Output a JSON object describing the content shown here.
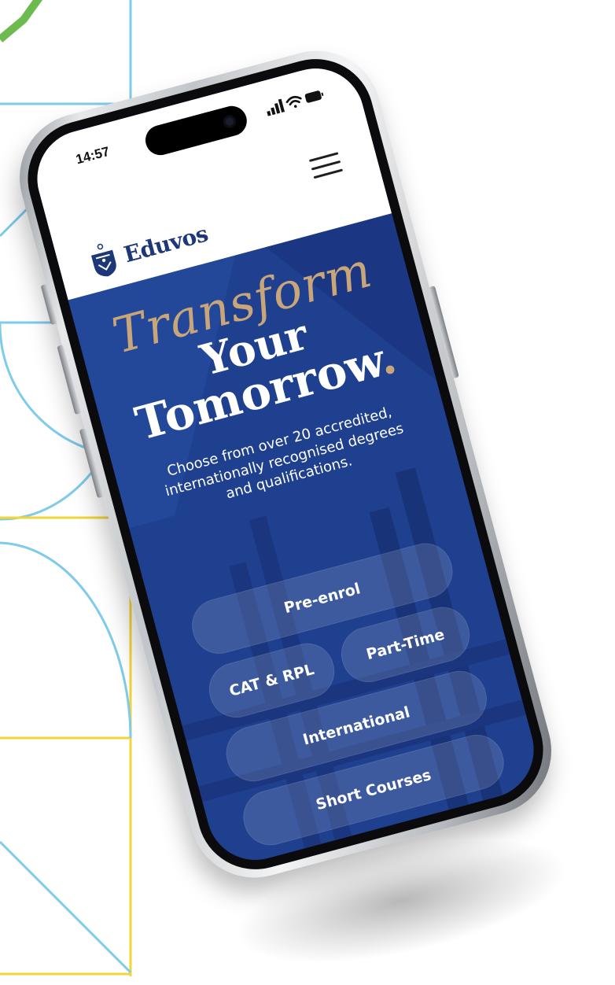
{
  "status_bar": {
    "time": "14:57"
  },
  "header": {
    "brand": "Eduvos",
    "menu_icon": "hamburger-menu-icon",
    "crest_icon": "crest-logo-icon"
  },
  "hero": {
    "line1": "Transform",
    "line2": "Your",
    "line3": "Tomorrow",
    "dot": ".",
    "subtitle": "Choose from over 20 accredited, internationally recognised degrees and qualifications."
  },
  "buttons": {
    "pre_enrol": "Pre-enrol",
    "cat_rpl": "CAT & RPL",
    "part_time": "Part-Time",
    "international": "International",
    "short_courses": "Short Courses"
  },
  "colors": {
    "brand_blue": "#1f3f8f",
    "gold": "#c9a67a",
    "line_blue": "#7ecbea",
    "line_yellow": "#f2d43b",
    "check_green": "#6dbb4f"
  }
}
